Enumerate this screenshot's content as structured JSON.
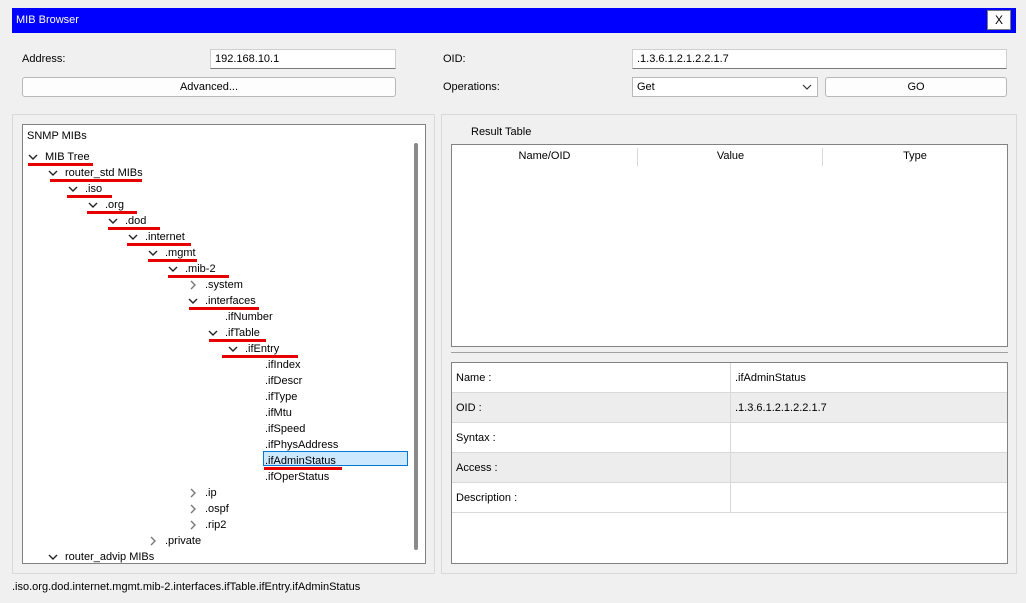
{
  "window": {
    "title": "MIB Browser",
    "close_label": "X"
  },
  "form": {
    "address_label": "Address:",
    "address_value": "192.168.10.1",
    "oid_label": "OID:",
    "oid_value": ".1.3.6.1.2.1.2.2.1.7",
    "advanced_label": "Advanced...",
    "operations_label": "Operations:",
    "operation_value": "Get",
    "go_label": "GO"
  },
  "tree": {
    "header": "SNMP MIBs",
    "selected": ".ifAdminStatus",
    "items": [
      {
        "label": "MIB Tree",
        "expanded": true
      },
      {
        "label": "router_std MIBs",
        "expanded": true
      },
      {
        "label": ".iso",
        "expanded": true
      },
      {
        "label": ".org",
        "expanded": true
      },
      {
        "label": ".dod",
        "expanded": true
      },
      {
        "label": ".internet",
        "expanded": true
      },
      {
        "label": ".mgmt",
        "expanded": true
      },
      {
        "label": ".mib-2",
        "expanded": true
      },
      {
        "label": ".system",
        "expanded": false
      },
      {
        "label": ".interfaces",
        "expanded": true
      },
      {
        "label": ".ifNumber"
      },
      {
        "label": ".ifTable",
        "expanded": true
      },
      {
        "label": ".ifEntry",
        "expanded": true
      },
      {
        "label": ".ifIndex"
      },
      {
        "label": ".ifDescr"
      },
      {
        "label": ".ifType"
      },
      {
        "label": ".ifMtu"
      },
      {
        "label": ".ifSpeed"
      },
      {
        "label": ".ifPhysAddress"
      },
      {
        "label": ".ifAdminStatus"
      },
      {
        "label": ".ifOperStatus"
      },
      {
        "label": ".ip",
        "expanded": false
      },
      {
        "label": ".ospf",
        "expanded": false
      },
      {
        "label": ".rip2",
        "expanded": false
      },
      {
        "label": ".private",
        "expanded": false
      },
      {
        "label": "router_advip MIBs",
        "expanded": true
      }
    ]
  },
  "result_table": {
    "title": "Result Table",
    "columns": [
      "Name/OID",
      "Value",
      "Type"
    ]
  },
  "details": {
    "rows": [
      {
        "label": "Name :",
        "value": ".ifAdminStatus"
      },
      {
        "label": "OID :",
        "value": ".1.3.6.1.2.1.2.2.1.7"
      },
      {
        "label": "Syntax :",
        "value": ""
      },
      {
        "label": "Access :",
        "value": ""
      },
      {
        "label": "Description :",
        "value": ""
      }
    ]
  },
  "status_bar": {
    "path": ".iso.org.dod.internet.mgmt.mib-2.interfaces.ifTable.ifEntry.ifAdminStatus"
  },
  "colors": {
    "titlebar": "#0000ff",
    "annotation_red": "#e60000",
    "selection": "#cce8ff"
  }
}
